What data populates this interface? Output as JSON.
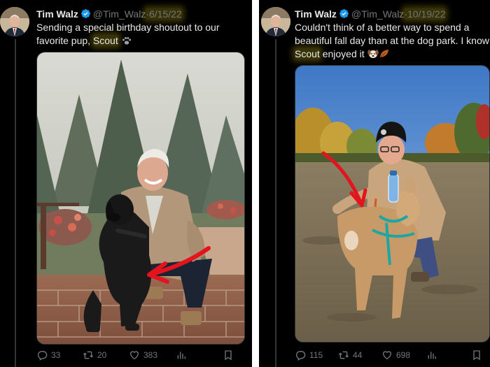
{
  "tweets": [
    {
      "author_name": "Tim Walz",
      "handle": "@Tim_Walz",
      "separator": "·",
      "date": "6/15/22",
      "text_line1": "Sending a special birthday shoutout to our",
      "text_line2_prefix": "favorite pup, ",
      "text_highlight": "Scout",
      "text_line2_suffix": " ",
      "emoji": "paw-prints-icon",
      "replies": "33",
      "reposts": "20",
      "likes": "383"
    },
    {
      "author_name": "Tim Walz",
      "handle": "@Tim_Walz",
      "separator": "·",
      "date": "10/19/22",
      "text_line1": "Couldn't think of a better way to spend a",
      "text_line2": "beautiful fall day than at the dog park. I know",
      "text_highlight": "Scout",
      "text_line3_suffix": " enjoyed it ",
      "emoji": "dog-face-icon, fallen-leaf-icon",
      "replies": "115",
      "reposts": "44",
      "likes": "698"
    }
  ],
  "colors": {
    "background": "#000000",
    "text": "#e7e9ea",
    "secondary": "#71767b",
    "verified": "#1d9bf0",
    "highlight": "#ffe61e",
    "arrow": "#e3141d"
  }
}
